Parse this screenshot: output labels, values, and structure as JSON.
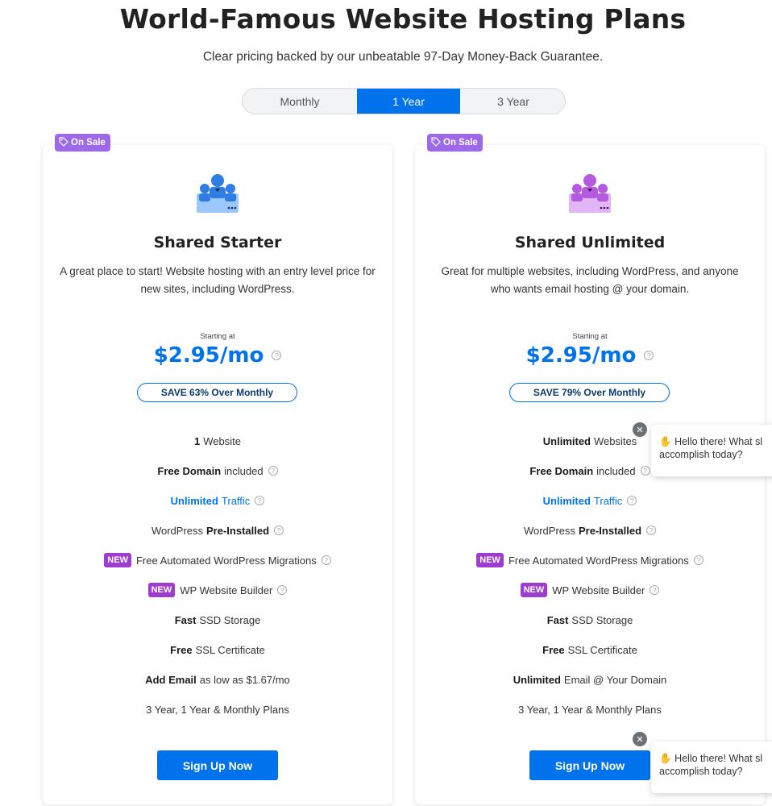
{
  "header": {
    "title": "World-Famous Website Hosting Plans",
    "subtitle": "Clear pricing backed by our unbeatable 97-Day Money-Back Guarantee."
  },
  "billing_toggle": {
    "options": [
      "Monthly",
      "1 Year",
      "3 Year"
    ],
    "selected": "1 Year"
  },
  "colors": {
    "accent": "#0073ec",
    "sale_badge": "#9e69e8",
    "new_badge": "#9e3ccf"
  },
  "plans": [
    {
      "badge": "On Sale",
      "icon": "users-group-icon",
      "name": "Shared Starter",
      "description": "A great place to start! Website hosting with an entry level price for new sites, including WordPress.",
      "starting_label": "Starting at",
      "price": "$2.95/mo",
      "save_label": "SAVE 63% Over Monthly",
      "features": [
        {
          "bold": "1",
          "text": " Website"
        },
        {
          "bold": "Free Domain",
          "text": " included"
        },
        {
          "bold": "Unlimited",
          "text": " Traffic"
        },
        {
          "pre": "WordPress ",
          "bold": "Pre-Installed"
        },
        {
          "new": "NEW",
          "text": "Free Automated WordPress Migrations"
        },
        {
          "new": "NEW",
          "text": "WP Website Builder"
        },
        {
          "bold": "Fast",
          "text": " SSD Storage"
        },
        {
          "bold": "Free",
          "text": " SSL Certificate"
        },
        {
          "bold": "Add Email",
          "text": " as low as $1.67/mo"
        },
        {
          "text": "3 Year, 1 Year & Monthly Plans"
        }
      ],
      "cta": "Sign Up Now"
    },
    {
      "badge": "On Sale",
      "icon": "users-group-icon",
      "name": "Shared Unlimited",
      "description": "Great for multiple websites, including WordPress, and anyone who wants email hosting @ your domain.",
      "starting_label": "Starting at",
      "price": "$2.95/mo",
      "save_label": "SAVE 79% Over Monthly",
      "features": [
        {
          "bold": "Unlimited",
          "text": " Websites"
        },
        {
          "bold": "Free Domain",
          "text": " included"
        },
        {
          "bold": "Unlimited",
          "text": " Traffic"
        },
        {
          "pre": "WordPress ",
          "bold": "Pre-Installed"
        },
        {
          "new": "NEW",
          "text": "Free Automated WordPress Migrations"
        },
        {
          "new": "NEW",
          "text": "WP Website Builder"
        },
        {
          "bold": "Fast",
          "text": " SSD Storage"
        },
        {
          "bold": "Free",
          "text": " SSL Certificate"
        },
        {
          "bold": "Unlimited",
          "text": " Email @ Your Domain"
        },
        {
          "text": "3 Year, 1 Year & Monthly Plans"
        }
      ],
      "cta": "Sign Up Now"
    }
  ],
  "chat": {
    "message_line1": "Hello there! What sl",
    "message_line2": "accomplish today?"
  }
}
